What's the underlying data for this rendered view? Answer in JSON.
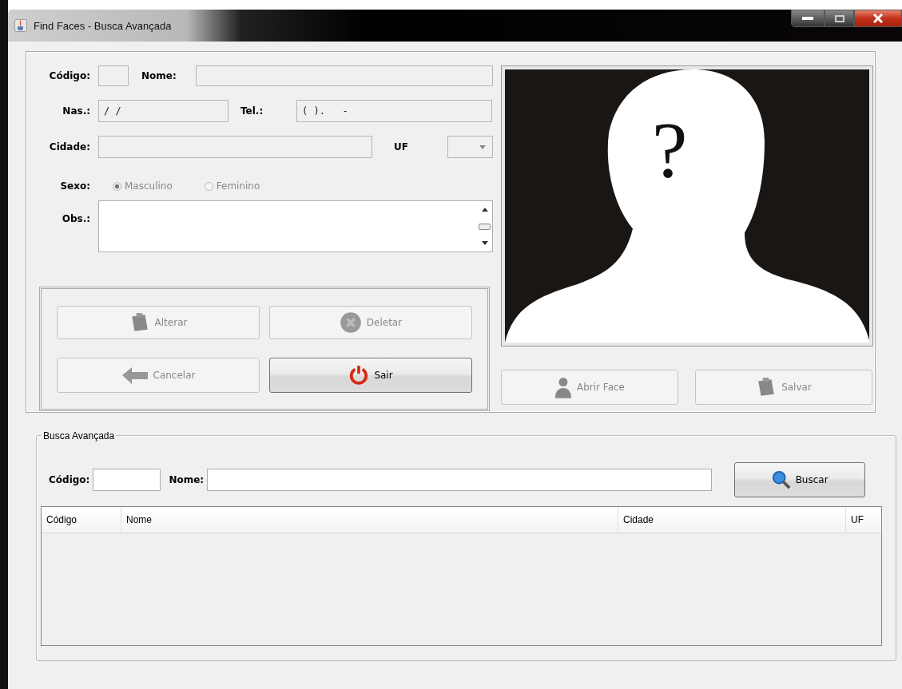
{
  "window": {
    "title": "Find Faces - Busca Avançada"
  },
  "form": {
    "rows": [
      [
        {
          "kind": "text",
          "label": "Código:",
          "disabled": true
        },
        {
          "kind": "text",
          "label": "Nome:",
          "disabled": true
        }
      ],
      [
        {
          "kind": "text",
          "label": "Nas.:",
          "value": "/ /",
          "disabled": true
        },
        {
          "kind": "text",
          "label": "Tel.:",
          "value": "( ).   -",
          "disabled": true
        }
      ],
      [
        {
          "kind": "text",
          "label": "Cidade:",
          "disabled": true
        },
        {
          "kind": "combo",
          "label": "UF",
          "disabled": true
        }
      ],
      [
        {
          "kind": "radios",
          "label": "Sexo:",
          "disabled": true,
          "options": [
            {
              "label": "Masculino",
              "selected": true
            },
            {
              "label": "Feminino",
              "selected": false
            }
          ]
        }
      ],
      [
        {
          "kind": "textarea",
          "label": "Obs.:",
          "disabled": false
        }
      ]
    ]
  },
  "actions": [
    {
      "label": "Alterar",
      "disabled": true
    },
    {
      "label": "Deletar",
      "disabled": true
    },
    {
      "label": "Cancelar",
      "disabled": true
    },
    {
      "label": "Sair",
      "disabled": false
    }
  ],
  "photo": {
    "mark": "?"
  },
  "photo_actions": [
    {
      "label": "Abrir Face",
      "disabled": true
    },
    {
      "label": "Salvar",
      "disabled": true
    }
  ],
  "search": {
    "title": "Busca Avançada",
    "fields": [
      {
        "label": "Código:"
      },
      {
        "label": "Nome:"
      }
    ],
    "button": {
      "label": "Buscar",
      "disabled": false
    },
    "table": {
      "columns": [
        "Código",
        "Nome",
        "Cidade",
        "UF"
      ]
    }
  }
}
